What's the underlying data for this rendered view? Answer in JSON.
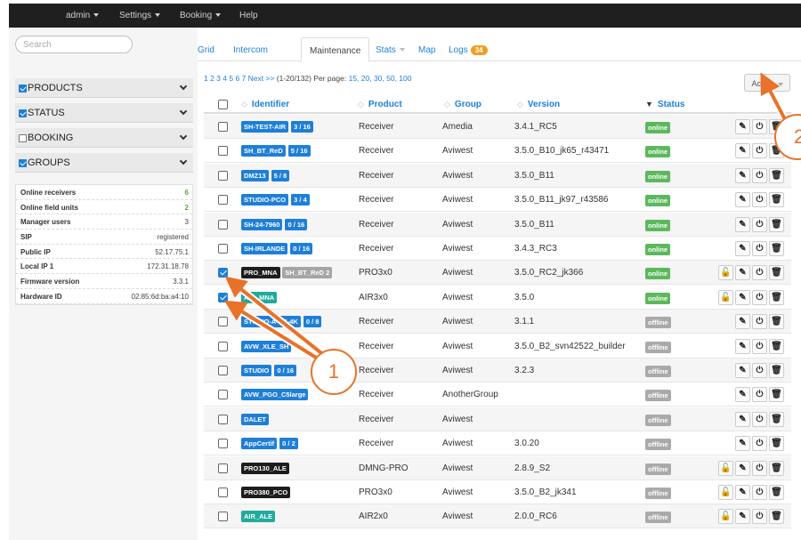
{
  "nav": {
    "items": [
      "admin",
      "Settings",
      "Booking",
      "Help"
    ]
  },
  "sidebar": {
    "search_placeholder": "Search",
    "facets": [
      {
        "label": "PRODUCTS",
        "checked": true
      },
      {
        "label": "STATUS",
        "checked": true
      },
      {
        "label": "BOOKING",
        "checked": false
      },
      {
        "label": "GROUPS",
        "checked": true
      }
    ],
    "stats": [
      {
        "key": "Online receivers",
        "value": "6",
        "green": true
      },
      {
        "key": "Online field units",
        "value": "2",
        "green": true
      },
      {
        "key": "Manager users",
        "value": "3",
        "green": false
      },
      {
        "key": "SIP",
        "value": "registered",
        "green": false
      },
      {
        "key": "Public IP",
        "value": "52.17.75.1",
        "green": false
      },
      {
        "key": "Local IP 1",
        "value": "172.31.18.78",
        "green": false
      },
      {
        "key": "Firmware version",
        "value": "3.3.1",
        "green": false
      },
      {
        "key": "Hardware ID",
        "value": "02:85:6d:ba:a4:10",
        "green": false
      }
    ]
  },
  "tabs": {
    "items": [
      "Grid",
      "Intercom",
      "Maintenance",
      "Stats",
      "Map",
      "Logs"
    ],
    "active": "Maintenance",
    "logs_badge": "34"
  },
  "pager": {
    "pages": "1 2 3 4 5 6 7 Next >>",
    "range": "(1-20/132) Per page:",
    "per_page": "15, 20, 30, 50, 100"
  },
  "action_label": "Action",
  "table": {
    "headers": {
      "identifier": "Identifier",
      "product": "Product",
      "group": "Group",
      "version": "Version",
      "status": "Status"
    },
    "rows": [
      {
        "checked": false,
        "labels": [
          {
            "text": "SH-TEST-AIR",
            "color": "blue"
          }
        ],
        "count": "3 / 16",
        "product": "Receiver",
        "group": "Amedia",
        "version": "3.4.1_RC5",
        "status": "online",
        "lock": false
      },
      {
        "checked": false,
        "labels": [
          {
            "text": "SH_BT_ReD",
            "color": "blue"
          }
        ],
        "count": "5 / 16",
        "product": "Receiver",
        "group": "Aviwest",
        "version": "3.5.0_B10_jk65_r43471",
        "status": "online",
        "lock": false
      },
      {
        "checked": false,
        "labels": [
          {
            "text": "DMZ13",
            "color": "blue"
          }
        ],
        "count": "5 / 8",
        "product": "Receiver",
        "group": "Aviwest",
        "version": "3.5.0_B11",
        "status": "online",
        "lock": false
      },
      {
        "checked": false,
        "labels": [
          {
            "text": "STUDIO-PCO",
            "color": "blue"
          }
        ],
        "count": "3 / 4",
        "product": "Receiver",
        "group": "Aviwest",
        "version": "3.5.0_B11_jk97_r43586",
        "status": "online",
        "lock": false
      },
      {
        "checked": false,
        "labels": [
          {
            "text": "SH-24-7960",
            "color": "blue"
          }
        ],
        "count": "0 / 16",
        "product": "Receiver",
        "group": "Aviwest",
        "version": "3.5.0_B11",
        "status": "online",
        "lock": false
      },
      {
        "checked": false,
        "labels": [
          {
            "text": "SH-IRLANDE",
            "color": "blue"
          }
        ],
        "count": "0 / 16",
        "product": "Receiver",
        "group": "Aviwest",
        "version": "3.4.3_RC3",
        "status": "online",
        "lock": false
      },
      {
        "checked": true,
        "labels": [
          {
            "text": "PRO_MNA",
            "color": "black"
          },
          {
            "text": "SH_BT_ReD 2",
            "color": "gray"
          }
        ],
        "count": "",
        "product": "PRO3x0",
        "group": "Aviwest",
        "version": "3.5.0_RC2_jk366",
        "status": "online",
        "lock": true
      },
      {
        "checked": true,
        "labels": [
          {
            "text": "AIR_MNA",
            "color": "teal"
          }
        ],
        "count": "",
        "product": "AIR3x0",
        "group": "Aviwest",
        "version": "3.5.0",
        "status": "online",
        "lock": true
      },
      {
        "checked": false,
        "labels": [
          {
            "text": "STUDIO-A-ES-4K",
            "color": "blue"
          }
        ],
        "count": "0 / 8",
        "product": "Receiver",
        "group": "Aviwest",
        "version": "3.1.1",
        "status": "offline",
        "lock": false
      },
      {
        "checked": false,
        "labels": [
          {
            "text": "AVW_XLE_SH",
            "color": "blue"
          }
        ],
        "count": "",
        "product": "Receiver",
        "group": "Aviwest",
        "version": "3.5.0_B2_svn42522_builder",
        "status": "offline",
        "lock": false
      },
      {
        "checked": false,
        "labels": [
          {
            "text": "STUDIO",
            "color": "blue"
          }
        ],
        "count": "0 / 16",
        "product": "Receiver",
        "group": "Aviwest",
        "version": "3.2.3",
        "status": "offline",
        "lock": false
      },
      {
        "checked": false,
        "labels": [
          {
            "text": "AVW_PGO_C5large",
            "color": "blue"
          }
        ],
        "count": "",
        "product": "Receiver",
        "group": "AnotherGroup",
        "version": "",
        "status": "offline",
        "lock": false
      },
      {
        "checked": false,
        "labels": [
          {
            "text": "DALET",
            "color": "blue"
          }
        ],
        "count": "",
        "product": "Receiver",
        "group": "Aviwest",
        "version": "",
        "status": "offline",
        "lock": false
      },
      {
        "checked": false,
        "labels": [
          {
            "text": "AppCertif",
            "color": "blue"
          }
        ],
        "count": "0 / 2",
        "product": "Receiver",
        "group": "Aviwest",
        "version": "3.0.20",
        "status": "offline",
        "lock": false
      },
      {
        "checked": false,
        "labels": [
          {
            "text": "PRO130_ALE",
            "color": "black"
          }
        ],
        "count": "",
        "product": "DMNG-PRO",
        "group": "Aviwest",
        "version": "2.8.9_S2",
        "status": "offline",
        "lock": true
      },
      {
        "checked": false,
        "labels": [
          {
            "text": "PRO380_PCO",
            "color": "black"
          }
        ],
        "count": "",
        "product": "PRO3x0",
        "group": "Aviwest",
        "version": "3.5.0_B2_jk341",
        "status": "offline",
        "lock": true
      },
      {
        "checked": false,
        "labels": [
          {
            "text": "AIR_ALE",
            "color": "teal"
          }
        ],
        "count": "",
        "product": "AIR2x0",
        "group": "Aviwest",
        "version": "2.0.0_RC6",
        "status": "offline",
        "lock": true
      }
    ]
  },
  "annotations": {
    "callout_1": "1",
    "callout_2": "2",
    "accent": "#e8722a"
  }
}
